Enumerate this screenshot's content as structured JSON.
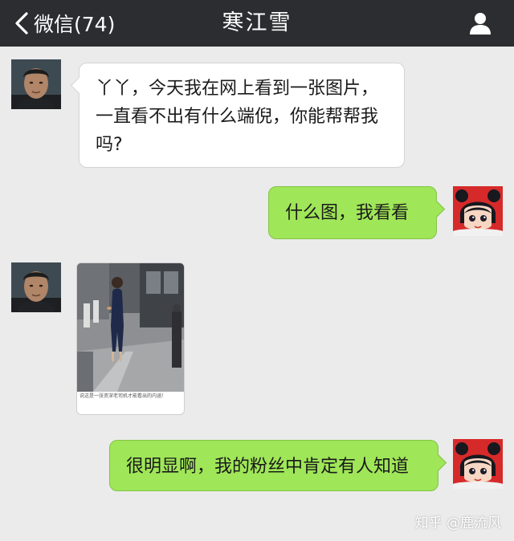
{
  "header": {
    "back_label": "微信(74)",
    "title": "寒江雪",
    "back_icon": "chevron-left-icon",
    "profile_icon": "person-icon",
    "background": "#2b2d30"
  },
  "messages": [
    {
      "sender": "contact",
      "type": "text",
      "text": "丫丫，今天我在网上看到一张图片，一直看不出有什么端倪，你能帮帮我吗?"
    },
    {
      "sender": "me",
      "type": "text",
      "text": "什么图，我看看"
    },
    {
      "sender": "contact",
      "type": "image",
      "caption": "说这是一张资深老司机才能看出的内涵！"
    },
    {
      "sender": "me",
      "type": "text",
      "text": "很明显啊，我的粉丝中肯定有人知道"
    }
  ],
  "watermark": "知乎 @鹿流风",
  "colors": {
    "chat_background": "#ebebeb",
    "bubble_incoming": "#ffffff",
    "bubble_outgoing": "#9fe658"
  }
}
